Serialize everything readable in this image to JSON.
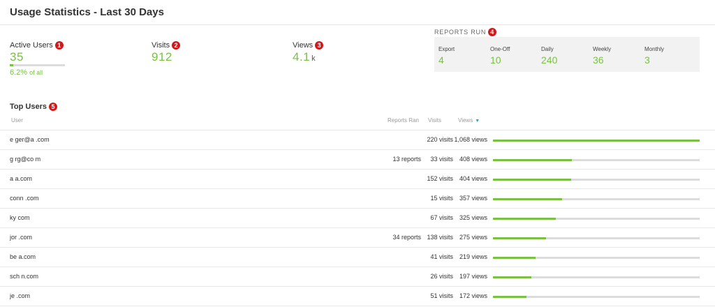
{
  "page": {
    "title": "Usage Statistics - Last 30 Days"
  },
  "stats": {
    "active_users": {
      "label": "Active Users",
      "badge": "1",
      "value": "35",
      "percent": "6.2%",
      "percent_suffix": "of all",
      "fraction": 0.062
    },
    "visits": {
      "label": "Visits",
      "badge": "2",
      "value": "912"
    },
    "views": {
      "label": "Views",
      "badge": "3",
      "value": "4.1",
      "unit": "k"
    }
  },
  "reports_run": {
    "title": "REPORTS RUN",
    "badge": "4",
    "items": [
      {
        "label": "Export",
        "value": "4"
      },
      {
        "label": "One-Off",
        "value": "10"
      },
      {
        "label": "Daily",
        "value": "240"
      },
      {
        "label": "Weekly",
        "value": "36"
      },
      {
        "label": "Monthly",
        "value": "3"
      }
    ]
  },
  "top_users": {
    "title": "Top Users",
    "badge": "5",
    "columns": {
      "user": "User",
      "reports": "Reports Ran",
      "visits": "Visits",
      "views": "Views"
    },
    "sort_icon": "sort-down-icon",
    "accent": "#7ac143",
    "rows": [
      {
        "user": "e ger@a .com",
        "reports": "",
        "visits": "220 visits",
        "views": "1,068 views",
        "views_value": 1068
      },
      {
        "user": "g rg@co m",
        "reports": "13 reports",
        "visits": "33 visits",
        "views": "408 views",
        "views_value": 408
      },
      {
        "user": "a a.com",
        "reports": "",
        "visits": "152 visits",
        "views": "404 views",
        "views_value": 404
      },
      {
        "user": "conn .com",
        "reports": "",
        "visits": "15 visits",
        "views": "357 views",
        "views_value": 357
      },
      {
        "user": "ky com",
        "reports": "",
        "visits": "67 visits",
        "views": "325 views",
        "views_value": 325
      },
      {
        "user": "jor .com",
        "reports": "34 reports",
        "visits": "138 visits",
        "views": "275 views",
        "views_value": 275
      },
      {
        "user": "be a.com",
        "reports": "",
        "visits": "41 visits",
        "views": "219 views",
        "views_value": 219
      },
      {
        "user": "sch n.com",
        "reports": "",
        "visits": "26 visits",
        "views": "197 views",
        "views_value": 197
      },
      {
        "user": "je .com",
        "reports": "",
        "visits": "51 visits",
        "views": "172 views",
        "views_value": 172
      }
    ]
  }
}
